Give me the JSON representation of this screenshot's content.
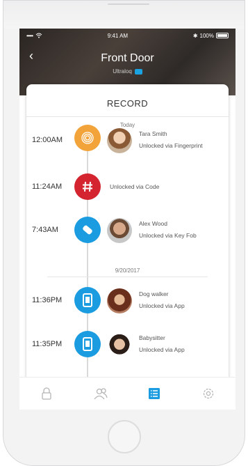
{
  "status_bar": {
    "carrier_dots": "•••••",
    "time": "9:41 AM",
    "battery": "100%"
  },
  "header": {
    "back_glyph": "‹",
    "title": "Front Door",
    "subtitle": "Ultraloq"
  },
  "record": {
    "title": "RECORD",
    "groups": [
      {
        "date": "Today",
        "entries": [
          {
            "time": "12:00AM",
            "icon": "fingerprint-icon",
            "icon_color": "#f2a43a",
            "name": "Tara Smith",
            "action": "Unlocked via Fingerprint",
            "avatar": true
          },
          {
            "time": "11:24AM",
            "icon": "hash-code-icon",
            "icon_color": "#d42430",
            "name": "",
            "action": "Unlocked via Code",
            "avatar": false
          },
          {
            "time": "7:43AM",
            "icon": "key-fob-icon",
            "icon_color": "#1b9be0",
            "name": "Alex Wood",
            "action": "Unlocked via Key Fob",
            "avatar": true
          }
        ]
      },
      {
        "date": "9/20/2017",
        "entries": [
          {
            "time": "11:36PM",
            "icon": "phone-app-icon",
            "icon_color": "#1b9be0",
            "name": "Dog walker",
            "action": "Unlocked via App",
            "avatar": true
          },
          {
            "time": "11:35PM",
            "icon": "phone-app-icon",
            "icon_color": "#1b9be0",
            "name": "Babysitter",
            "action": "Unlocked via App",
            "avatar": true
          }
        ]
      }
    ]
  },
  "nav": {
    "items": [
      {
        "icon": "lock-icon",
        "active": false
      },
      {
        "icon": "users-icon",
        "active": false
      },
      {
        "icon": "records-list-icon",
        "active": true
      },
      {
        "icon": "settings-gear-icon",
        "active": false
      }
    ],
    "active_color": "#1b9be0",
    "inactive_color": "#b5b5b5"
  }
}
